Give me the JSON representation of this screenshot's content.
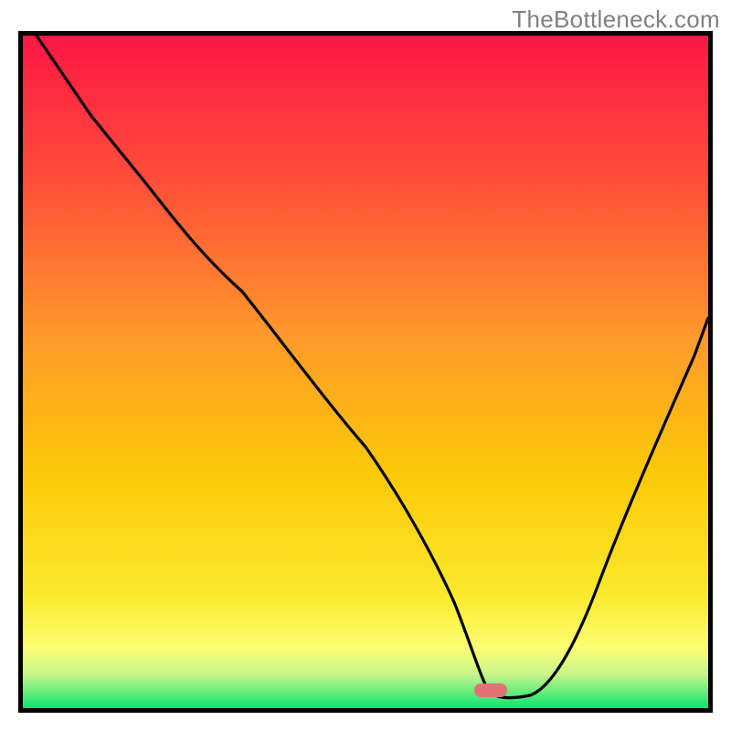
{
  "watermark": "TheBottleneck.com",
  "chart_data": {
    "type": "line",
    "title": "",
    "xlabel": "",
    "ylabel": "",
    "xlim": [
      0,
      100
    ],
    "ylim": [
      0,
      100
    ],
    "background_gradient": {
      "top": "#fd1745",
      "mid_upper": "#ff7e2f",
      "mid": "#fac800",
      "mid_lower": "#fdfe5e",
      "bottom": "#0be36e"
    },
    "marker": {
      "x": 68,
      "y": 2.5,
      "color": "#e27176",
      "shape": "rounded-horizontal-pill"
    },
    "series": [
      {
        "name": "bottleneck-curve",
        "color": "#000000",
        "x": [
          2,
          10,
          18,
          25,
          32,
          40,
          48,
          55,
          60,
          63,
          66,
          70,
          73,
          78,
          84,
          90,
          96,
          100
        ],
        "y": [
          100,
          88,
          78,
          70.5,
          62,
          51,
          40,
          29,
          19,
          11,
          4,
          2,
          2,
          6,
          18,
          32,
          47,
          58
        ]
      }
    ],
    "notes": "No axis tick labels or gridlines are visible; values are estimated on a 0–100 normalized scale. Curve descends steeply from top-left, flattens near the bottom around x≈66–73, then rises toward the right edge."
  }
}
